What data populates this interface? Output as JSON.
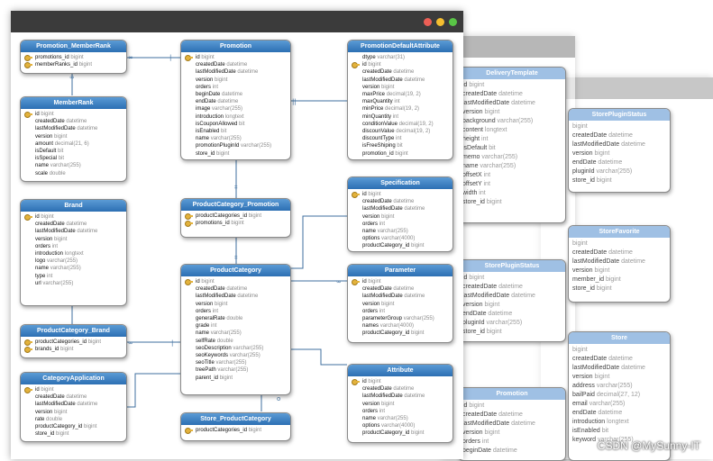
{
  "watermark": "CSDN @MySunny-IT",
  "colors": {
    "header_top": "#5b9bd5",
    "header_bottom": "#2c6fb3",
    "link": "#3f6f9f",
    "key": "#e3b23c",
    "dot_red": "#ed5f56",
    "dot_yellow": "#f5be30",
    "dot_green": "#59c546"
  },
  "tables": {
    "promotion_memberrank": {
      "title": "Promotion_MemberRank",
      "rows": [
        {
          "n": "promotions_id",
          "t": "bigint",
          "k": true
        },
        {
          "n": "memberRanks_id",
          "t": "bigint",
          "k": true
        }
      ]
    },
    "memberrank": {
      "title": "MemberRank",
      "rows": [
        {
          "n": "id",
          "t": "bigint",
          "k": true
        },
        {
          "n": "createdDate",
          "t": "datetime"
        },
        {
          "n": "lastModifiedDate",
          "t": "datetime"
        },
        {
          "n": "version",
          "t": "bigint"
        },
        {
          "n": "amount",
          "t": "decimal(21, 6)"
        },
        {
          "n": "isDefault",
          "t": "bit"
        },
        {
          "n": "isSpecial",
          "t": "bit"
        },
        {
          "n": "name",
          "t": "varchar(255)"
        },
        {
          "n": "scale",
          "t": "double"
        }
      ]
    },
    "brand": {
      "title": "Brand",
      "rows": [
        {
          "n": "id",
          "t": "bigint",
          "k": true
        },
        {
          "n": "createdDate",
          "t": "datetime"
        },
        {
          "n": "lastModifiedDate",
          "t": "datetime"
        },
        {
          "n": "version",
          "t": "bigint"
        },
        {
          "n": "orders",
          "t": "int"
        },
        {
          "n": "introduction",
          "t": "longtext"
        },
        {
          "n": "logo",
          "t": "varchar(255)"
        },
        {
          "n": "name",
          "t": "varchar(255)"
        },
        {
          "n": "type",
          "t": "int"
        },
        {
          "n": "url",
          "t": "varchar(255)"
        }
      ]
    },
    "productcategory_brand": {
      "title": "ProductCategory_Brand",
      "rows": [
        {
          "n": "productCategories_id",
          "t": "bigint",
          "k": true
        },
        {
          "n": "brands_id",
          "t": "bigint",
          "k": true
        }
      ]
    },
    "categoryapplication": {
      "title": "CategoryApplication",
      "rows": [
        {
          "n": "id",
          "t": "bigint",
          "k": true
        },
        {
          "n": "createdDate",
          "t": "datetime"
        },
        {
          "n": "lastModifiedDate",
          "t": "datetime"
        },
        {
          "n": "version",
          "t": "bigint"
        },
        {
          "n": "rate",
          "t": "double"
        },
        {
          "n": "productCategory_id",
          "t": "bigint"
        },
        {
          "n": "store_id",
          "t": "bigint"
        }
      ]
    },
    "promotion": {
      "title": "Promotion",
      "rows": [
        {
          "n": "id",
          "t": "bigint",
          "k": true
        },
        {
          "n": "createdDate",
          "t": "datetime"
        },
        {
          "n": "lastModifiedDate",
          "t": "datetime"
        },
        {
          "n": "version",
          "t": "bigint"
        },
        {
          "n": "orders",
          "t": "int"
        },
        {
          "n": "beginDate",
          "t": "datetime"
        },
        {
          "n": "endDate",
          "t": "datetime"
        },
        {
          "n": "image",
          "t": "varchar(255)"
        },
        {
          "n": "introduction",
          "t": "longtext"
        },
        {
          "n": "isCouponAllowed",
          "t": "bit"
        },
        {
          "n": "isEnabled",
          "t": "bit"
        },
        {
          "n": "name",
          "t": "varchar(255)"
        },
        {
          "n": "promotionPluginId",
          "t": "varchar(255)"
        },
        {
          "n": "store_id",
          "t": "bigint"
        }
      ]
    },
    "productcategory_promotion": {
      "title": "ProductCategory_Promotion",
      "rows": [
        {
          "n": "productCategories_id",
          "t": "bigint",
          "k": true
        },
        {
          "n": "promotions_id",
          "t": "bigint",
          "k": true
        }
      ]
    },
    "productcategory": {
      "title": "ProductCategory",
      "rows": [
        {
          "n": "id",
          "t": "bigint",
          "k": true
        },
        {
          "n": "createdDate",
          "t": "datetime"
        },
        {
          "n": "lastModifiedDate",
          "t": "datetime"
        },
        {
          "n": "version",
          "t": "bigint"
        },
        {
          "n": "orders",
          "t": "int"
        },
        {
          "n": "generalRate",
          "t": "double"
        },
        {
          "n": "grade",
          "t": "int"
        },
        {
          "n": "name",
          "t": "varchar(255)"
        },
        {
          "n": "selfRate",
          "t": "double"
        },
        {
          "n": "seoDescription",
          "t": "varchar(255)"
        },
        {
          "n": "seoKeywords",
          "t": "varchar(255)"
        },
        {
          "n": "seoTitle",
          "t": "varchar(255)"
        },
        {
          "n": "treePath",
          "t": "varchar(255)"
        },
        {
          "n": "parent_id",
          "t": "bigint"
        }
      ]
    },
    "store_productcategory": {
      "title": "Store_ProductCategory",
      "rows": [
        {
          "n": "productCategories_id",
          "t": "bigint",
          "k": true
        }
      ]
    },
    "promotiondefaultattribute": {
      "title": "PromotionDefaultAttribute",
      "rows": [
        {
          "n": "dtype",
          "t": "varchar(31)"
        },
        {
          "n": "id",
          "t": "bigint",
          "k": true
        },
        {
          "n": "createdDate",
          "t": "datetime"
        },
        {
          "n": "lastModifiedDate",
          "t": "datetime"
        },
        {
          "n": "version",
          "t": "bigint"
        },
        {
          "n": "maxPrice",
          "t": "decimal(19, 2)"
        },
        {
          "n": "maxQuantity",
          "t": "int"
        },
        {
          "n": "minPrice",
          "t": "decimal(19, 2)"
        },
        {
          "n": "minQuantity",
          "t": "int"
        },
        {
          "n": "conditionValue",
          "t": "decimal(19, 2)"
        },
        {
          "n": "discounValue",
          "t": "decimal(19, 2)"
        },
        {
          "n": "discountType",
          "t": "int"
        },
        {
          "n": "isFreeShiping",
          "t": "bit"
        },
        {
          "n": "promotion_id",
          "t": "bigint"
        }
      ]
    },
    "specification": {
      "title": "Specification",
      "rows": [
        {
          "n": "id",
          "t": "bigint",
          "k": true
        },
        {
          "n": "createdDate",
          "t": "datetime"
        },
        {
          "n": "lastModifiedDate",
          "t": "datetime"
        },
        {
          "n": "version",
          "t": "bigint"
        },
        {
          "n": "orders",
          "t": "int"
        },
        {
          "n": "name",
          "t": "varchar(255)"
        },
        {
          "n": "options",
          "t": "varchar(4000)"
        },
        {
          "n": "productCategory_id",
          "t": "bigint"
        }
      ]
    },
    "parameter": {
      "title": "Parameter",
      "rows": [
        {
          "n": "id",
          "t": "bigint",
          "k": true
        },
        {
          "n": "createdDate",
          "t": "datetime"
        },
        {
          "n": "lastModifiedDate",
          "t": "datetime"
        },
        {
          "n": "version",
          "t": "bigint"
        },
        {
          "n": "orders",
          "t": "int"
        },
        {
          "n": "parameterGroup",
          "t": "varchar(255)"
        },
        {
          "n": "names",
          "t": "varchar(4000)"
        },
        {
          "n": "productCategory_id",
          "t": "bigint"
        }
      ]
    },
    "attribute": {
      "title": "Attribute",
      "rows": [
        {
          "n": "id",
          "t": "bigint",
          "k": true
        },
        {
          "n": "createdDate",
          "t": "datetime"
        },
        {
          "n": "lastModifiedDate",
          "t": "datetime"
        },
        {
          "n": "version",
          "t": "bigint"
        },
        {
          "n": "orders",
          "t": "int"
        },
        {
          "n": "name",
          "t": "varchar(255)"
        },
        {
          "n": "options",
          "t": "varchar(4000)"
        },
        {
          "n": "productCategory_id",
          "t": "bigint"
        }
      ]
    },
    "deliverytemplate": {
      "title": "DeliveryTemplate",
      "rows": [
        {
          "n": "id",
          "t": "bigint"
        },
        {
          "n": "createdDate",
          "t": "datetime"
        },
        {
          "n": "lastModifiedDate",
          "t": "datetime"
        },
        {
          "n": "version",
          "t": "bigint"
        },
        {
          "n": "background",
          "t": "varchar(255)"
        },
        {
          "n": "content",
          "t": "longtext"
        },
        {
          "n": "height",
          "t": "int"
        },
        {
          "n": "isDefault",
          "t": "bit"
        },
        {
          "n": "memo",
          "t": "varchar(255)"
        },
        {
          "n": "name",
          "t": "varchar(255)"
        },
        {
          "n": "offsetX",
          "t": "int"
        },
        {
          "n": "offsetY",
          "t": "int"
        },
        {
          "n": "width",
          "t": "int"
        },
        {
          "n": "store_id",
          "t": "bigint"
        }
      ]
    },
    "storepluginstatus_mid": {
      "title": "StorePluginStatus",
      "rows": [
        {
          "n": "id",
          "t": "bigint"
        },
        {
          "n": "createdDate",
          "t": "datetime"
        },
        {
          "n": "lastModifiedDate",
          "t": "datetime"
        },
        {
          "n": "version",
          "t": "bigint"
        },
        {
          "n": "endDate",
          "t": "datetime"
        },
        {
          "n": "pluginId",
          "t": "varchar(255)"
        },
        {
          "n": "store_id",
          "t": "bigint"
        }
      ]
    },
    "promotion_mid": {
      "title": "Promotion",
      "rows": [
        {
          "n": "id",
          "t": "bigint"
        },
        {
          "n": "createdDate",
          "t": "datetime"
        },
        {
          "n": "lastModifiedDate",
          "t": "datetime"
        },
        {
          "n": "version",
          "t": "bigint"
        },
        {
          "n": "orders",
          "t": "int"
        },
        {
          "n": "beginDate",
          "t": "datetime"
        }
      ]
    },
    "storepluginstatus_back": {
      "title": "StorePluginStatus",
      "rows": [
        {
          "n": "",
          "t": "bigint"
        },
        {
          "n": "createdDate",
          "t": "datetime"
        },
        {
          "n": "lastModifiedDate",
          "t": "datetime"
        },
        {
          "n": "version",
          "t": "bigint"
        },
        {
          "n": "endDate",
          "t": "datetime"
        },
        {
          "n": "pluginId",
          "t": "varchar(255)"
        },
        {
          "n": "store_id",
          "t": "bigint"
        }
      ]
    },
    "storefavorite": {
      "title": "StoreFavorite",
      "rows": [
        {
          "n": "",
          "t": "bigint"
        },
        {
          "n": "createdDate",
          "t": "datetime"
        },
        {
          "n": "lastModifiedDate",
          "t": "datetime"
        },
        {
          "n": "version",
          "t": "bigint"
        },
        {
          "n": "member_id",
          "t": "bigint"
        },
        {
          "n": "store_id",
          "t": "bigint"
        }
      ]
    },
    "store": {
      "title": "Store",
      "rows": [
        {
          "n": "",
          "t": "bigint"
        },
        {
          "n": "createdDate",
          "t": "datetime"
        },
        {
          "n": "lastModifiedDate",
          "t": "datetime"
        },
        {
          "n": "version",
          "t": "bigint"
        },
        {
          "n": "address",
          "t": "varchar(255)"
        },
        {
          "n": "bailPaid",
          "t": "decimal(27, 12)"
        },
        {
          "n": "email",
          "t": "varchar(255)"
        },
        {
          "n": "endDate",
          "t": "datetime"
        },
        {
          "n": "introduction",
          "t": "longtext"
        },
        {
          "n": "isEnabled",
          "t": "bit"
        },
        {
          "n": "keyword",
          "t": "varchar(255)"
        }
      ]
    }
  }
}
